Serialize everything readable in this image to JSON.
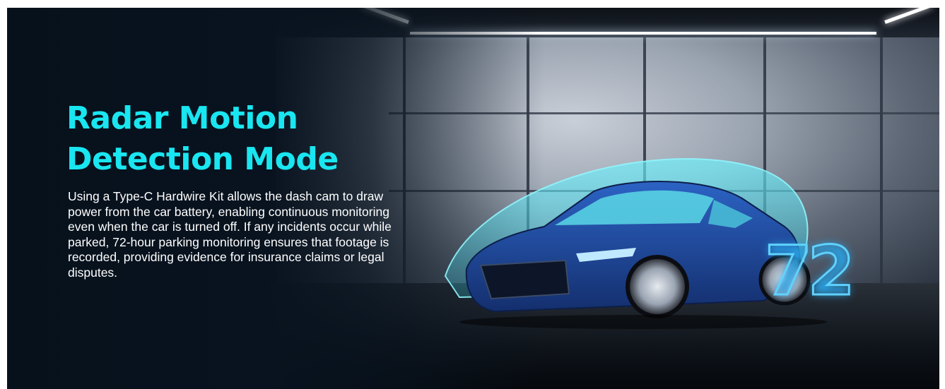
{
  "banner": {
    "title_line1": "Radar Motion",
    "title_line2": "Detection Mode",
    "description": "Using a Type-C Hardwire Kit allows the dash cam to draw power from the car battery, enabling continuous monitoring even when the car is turned off. If any incidents occur while parked, 72-hour parking monitoring ensures that footage is recorded, providing evidence for insurance claims or legal disputes.",
    "badge_number": "72"
  },
  "colors": {
    "title": "#19e6f0",
    "background": "#08131f",
    "shield_glow": "#5ef0ff",
    "car_body": "#1f4fa8"
  },
  "icons": [
    "car-image",
    "motion-shield",
    "72-hour-badge"
  ]
}
